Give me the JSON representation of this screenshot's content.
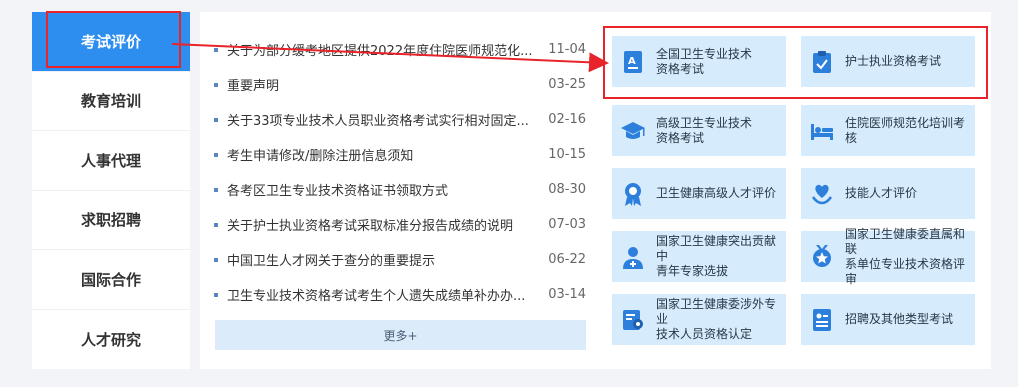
{
  "sidebar": {
    "items": [
      {
        "label": "考试评价"
      },
      {
        "label": "教育培训"
      },
      {
        "label": "人事代理"
      },
      {
        "label": "求职招聘"
      },
      {
        "label": "国际合作"
      },
      {
        "label": "人才研究"
      }
    ],
    "active_index": 0
  },
  "news": {
    "items": [
      {
        "title": "关于为部分缓考地区提供2022年度住院医师规范化...",
        "date": "11-04"
      },
      {
        "title": "重要声明",
        "date": "03-25"
      },
      {
        "title": "关于33项专业技术人员职业资格考试实行相对固定...",
        "date": "02-16"
      },
      {
        "title": "考生申请修改/删除注册信息须知",
        "date": "10-15"
      },
      {
        "title": "各考区卫生专业技术资格证书领取方式",
        "date": "08-30"
      },
      {
        "title": "关于护士执业资格考试采取标准分报告成绩的说明",
        "date": "07-03"
      },
      {
        "title": "中国卫生人才网关于查分的重要提示",
        "date": "06-22"
      },
      {
        "title": "卫生专业技术资格考试考生个人遗失成绩单补办办...",
        "date": "03-14"
      }
    ],
    "more_label": "更多+"
  },
  "categories": [
    {
      "line1": "全国卫生专业技术",
      "line2": "资格考试",
      "icon": "exam-paper-icon"
    },
    {
      "line1": "护士执业资格考试",
      "line2": "",
      "icon": "clipboard-check-icon"
    },
    {
      "line1": "高级卫生专业技术",
      "line2": "资格考试",
      "icon": "graduation-cap-icon"
    },
    {
      "line1": "住院医师规范化培训考",
      "line2": "核",
      "icon": "hospital-bed-icon"
    },
    {
      "line1": "卫生健康高级人才评价",
      "line2": "",
      "icon": "award-medal-icon"
    },
    {
      "line1": "技能人才评价",
      "line2": "",
      "icon": "heart-hands-icon"
    },
    {
      "line1": "国家卫生健康突出贡献中",
      "line2": "青年专家选拔",
      "icon": "doctor-icon"
    },
    {
      "line1": "国家卫生健康委直属和联",
      "line2": "系单位专业技术资格评审",
      "icon": "badge-star-icon"
    },
    {
      "line1": "国家卫生健康委涉外专业",
      "line2": "技术人员资格认定",
      "icon": "certificate-icon"
    },
    {
      "line1": "招聘及其他类型考试",
      "line2": "",
      "icon": "document-list-icon"
    }
  ],
  "colors": {
    "accent": "#2e8ef0",
    "card_bg": "#d6ebfb",
    "icon_blue": "#2d7fdc",
    "annotation_red": "#e8232a"
  }
}
